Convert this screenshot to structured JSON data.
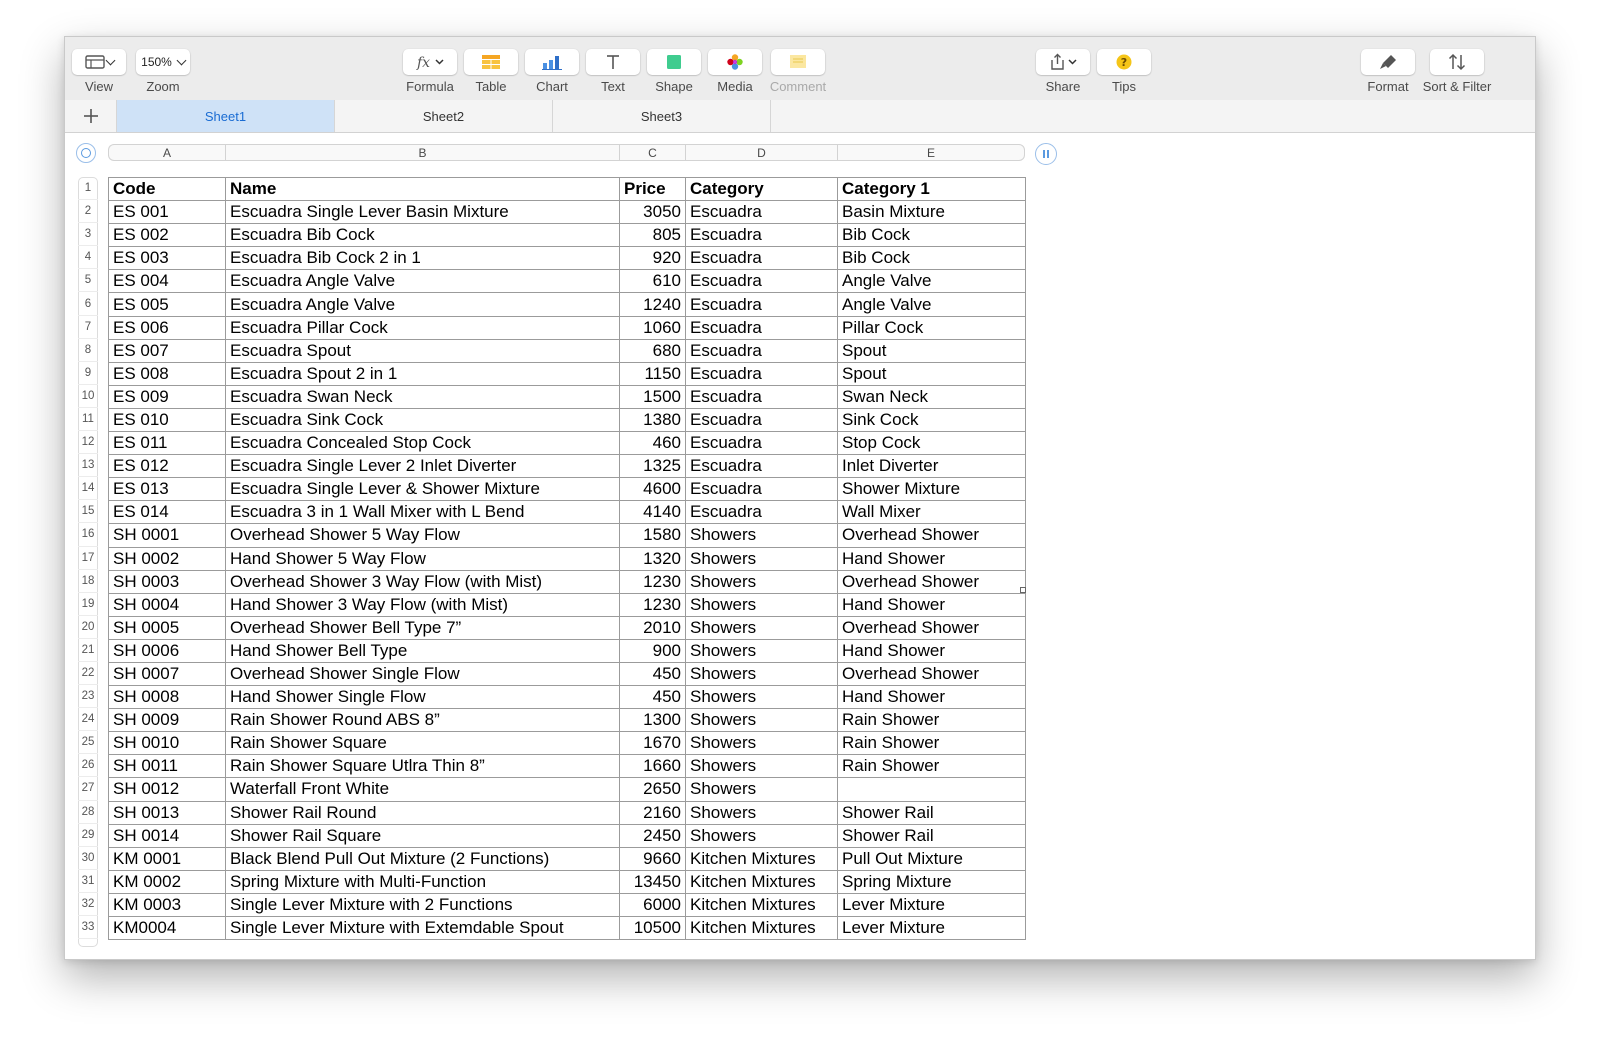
{
  "toolbar": {
    "view": {
      "label": "View"
    },
    "zoom": {
      "value": "150%",
      "label": "Zoom"
    },
    "formula": {
      "label": "Formula"
    },
    "table": {
      "label": "Table"
    },
    "chart": {
      "label": "Chart"
    },
    "text": {
      "label": "Text"
    },
    "shape": {
      "label": "Shape"
    },
    "media": {
      "label": "Media"
    },
    "comment": {
      "label": "Comment"
    },
    "share": {
      "label": "Share"
    },
    "tips": {
      "label": "Tips"
    },
    "format": {
      "label": "Format"
    },
    "sort": {
      "label": "Sort & Filter"
    }
  },
  "sheets": [
    "Sheet1",
    "Sheet2",
    "Sheet3"
  ],
  "active_sheet": "Sheet1",
  "columns": [
    "A",
    "B",
    "C",
    "D",
    "E"
  ],
  "table": {
    "header": [
      "Code",
      "Name",
      "Price",
      "Category",
      "Category 1"
    ],
    "rows": [
      [
        "ES 001",
        "Escuadra Single Lever Basin Mixture",
        "3050",
        "Escuadra",
        "Basin Mixture"
      ],
      [
        "ES 002",
        "Escuadra Bib Cock",
        "805",
        "Escuadra",
        "Bib Cock"
      ],
      [
        "ES 003",
        "Escuadra Bib Cock 2 in 1",
        "920",
        "Escuadra",
        "Bib Cock"
      ],
      [
        "ES 004",
        "Escuadra Angle Valve",
        "610",
        "Escuadra",
        "Angle Valve"
      ],
      [
        "ES 005",
        "Escuadra Angle Valve",
        "1240",
        "Escuadra",
        "Angle Valve"
      ],
      [
        "ES 006",
        "Escuadra Pillar Cock",
        "1060",
        "Escuadra",
        "Pillar Cock"
      ],
      [
        "ES 007",
        "Escuadra Spout",
        "680",
        "Escuadra",
        "Spout"
      ],
      [
        "ES 008",
        "Escuadra Spout 2 in 1",
        "1150",
        "Escuadra",
        "Spout"
      ],
      [
        "ES 009",
        "Escuadra Swan Neck",
        "1500",
        "Escuadra",
        "Swan Neck"
      ],
      [
        "ES 010",
        "Escuadra Sink Cock",
        "1380",
        "Escuadra",
        "Sink Cock"
      ],
      [
        "ES 011",
        "Escuadra Concealed Stop Cock",
        "460",
        "Escuadra",
        "Stop Cock"
      ],
      [
        "ES 012",
        "Escuadra Single Lever 2 Inlet Diverter",
        "1325",
        "Escuadra",
        "Inlet Diverter"
      ],
      [
        "ES 013",
        "Escuadra Single Lever & Shower Mixture",
        "4600",
        "Escuadra",
        "Shower Mixture"
      ],
      [
        "ES 014",
        "Escuadra 3 in 1 Wall Mixer with L Bend",
        "4140",
        "Escuadra",
        "Wall Mixer"
      ],
      [
        "SH 0001",
        "Overhead Shower 5 Way Flow",
        "1580",
        "Showers",
        "Overhead Shower"
      ],
      [
        "SH 0002",
        "Hand Shower 5 Way Flow",
        "1320",
        "Showers",
        "Hand Shower"
      ],
      [
        "SH 0003",
        "Overhead Shower 3 Way Flow (with Mist)",
        "1230",
        "Showers",
        "Overhead Shower"
      ],
      [
        "SH 0004",
        "Hand Shower 3 Way Flow (with Mist)",
        "1230",
        "Showers",
        "Hand Shower"
      ],
      [
        "SH 0005",
        "Overhead Shower Bell Type 7”",
        "2010",
        "Showers",
        "Overhead Shower"
      ],
      [
        "SH 0006",
        "Hand Shower Bell Type",
        "900",
        "Showers",
        "Hand Shower"
      ],
      [
        "SH 0007",
        "Overhead Shower Single Flow",
        "450",
        "Showers",
        "Overhead Shower"
      ],
      [
        "SH 0008",
        "Hand Shower Single Flow",
        "450",
        "Showers",
        "Hand Shower"
      ],
      [
        "SH 0009",
        "Rain Shower Round ABS 8”",
        "1300",
        "Showers",
        "Rain Shower"
      ],
      [
        "SH 0010",
        "Rain Shower Square",
        "1670",
        "Showers",
        "Rain Shower"
      ],
      [
        "SH 0011",
        "Rain Shower Square Utlra Thin 8”",
        "1660",
        "Showers",
        "Rain Shower"
      ],
      [
        "SH 0012",
        "Waterfall Front White",
        "2650",
        "Showers",
        ""
      ],
      [
        "SH 0013",
        "Shower Rail Round",
        "2160",
        "Showers",
        "Shower Rail"
      ],
      [
        "SH 0014",
        "Shower Rail Square",
        "2450",
        "Showers",
        "Shower Rail"
      ],
      [
        "KM 0001",
        "Black Blend Pull Out Mixture (2 Functions)",
        "9660",
        "Kitchen Mixtures",
        "Pull Out Mixture"
      ],
      [
        "KM 0002",
        "Spring Mixture with Multi-Function",
        "13450",
        "Kitchen Mixtures",
        "Spring Mixture"
      ],
      [
        "KM 0003",
        "Single Lever Mixture with 2 Functions",
        "6000",
        "Kitchen Mixtures",
        "Lever Mixture"
      ],
      [
        "KM0004",
        "Single Lever Mixture with Extemdable Spout",
        "10500",
        "Kitchen Mixtures",
        "Lever Mixture"
      ]
    ]
  },
  "row_numbers": [
    "1",
    "2",
    "3",
    "4",
    "5",
    "6",
    "7",
    "8",
    "9",
    "10",
    "11",
    "12",
    "13",
    "14",
    "15",
    "16",
    "17",
    "18",
    "19",
    "20",
    "21",
    "22",
    "23",
    "24",
    "25",
    "26",
    "27",
    "28",
    "29",
    "30",
    "31",
    "32",
    "33"
  ]
}
